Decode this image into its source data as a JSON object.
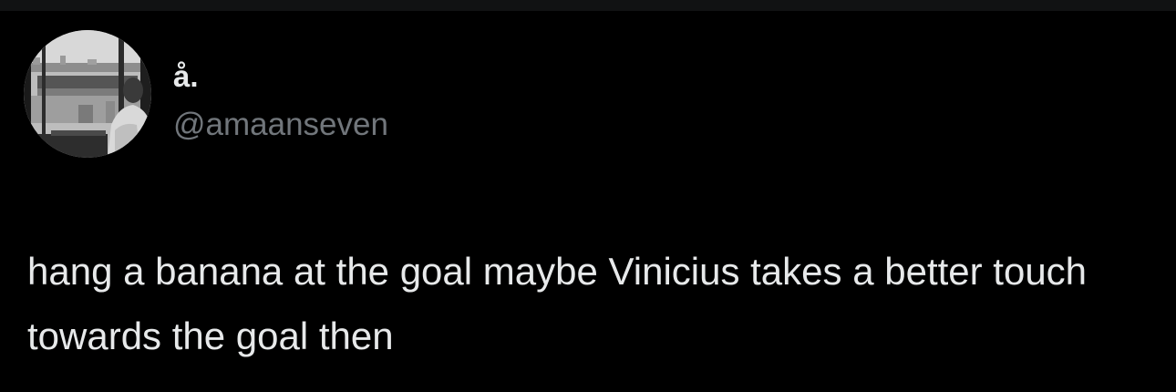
{
  "tweet": {
    "author": {
      "display_name": "å.",
      "handle": "@amaanseven",
      "avatar_icon": "profile-photo"
    },
    "text": "hang a banana at the goal maybe Vinicius takes a better touch towards the goal then"
  },
  "colors": {
    "background": "#000000",
    "primary_text": "#e7e9ea",
    "secondary_text": "#71767b"
  }
}
